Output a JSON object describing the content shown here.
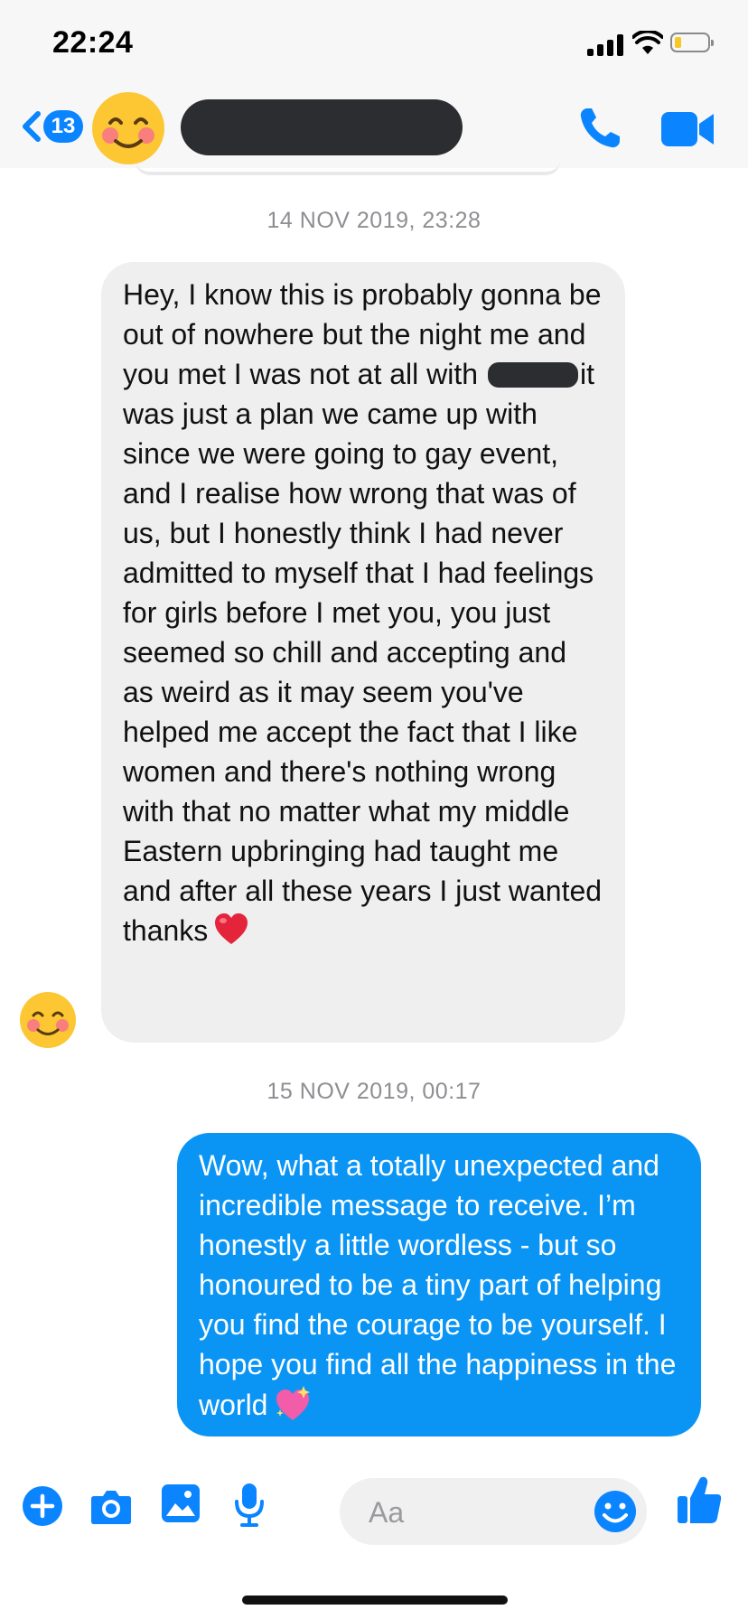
{
  "status_bar": {
    "time": "22:24",
    "battery_level": 0.2,
    "icons": [
      "cellular-signal-icon",
      "wifi-icon",
      "battery-icon"
    ]
  },
  "header": {
    "back_badge_count": "13",
    "avatar_emoji": "smiling-face-with-smiling-eyes-icon",
    "contact_name_redacted": true,
    "icons": [
      "back-chevron-icon",
      "phone-call-icon",
      "video-call-icon"
    ],
    "accent_color": "#0a84ff"
  },
  "conversation": {
    "messages": [
      {
        "timestamp": "14 NOV 2019, 23:28",
        "direction": "incoming",
        "text_before_redaction": "Hey, I know this is probably gonna be out of nowhere but the night me and you met I was not at all with",
        "text_after_redaction": "it was just a plan we came up with since we were going to gay event, and I realise how wrong that was of us, but I honestly think I had never admitted to myself that I had feelings for girls before I met you, you just seemed so chill and accepting and as weird as it may seem you've helped me accept the fact that I like women and there's nothing wrong with that no matter what my middle Eastern upbringing had taught me and after all these years I just wanted thanks",
        "emoji": "red-heart-icon",
        "bubble_color": "#efefef"
      },
      {
        "timestamp": "15 NOV 2019, 00:17",
        "direction": "outgoing",
        "text": "Wow, what a totally unexpected and incredible message to receive. I’m honestly a little wordless - but so honoured to be a tiny part of helping you find the courage to be yourself. I hope you find all the happiness in the world",
        "emoji": "sparkling-heart-icon",
        "bubble_color": "#0a95f5"
      }
    ]
  },
  "composer": {
    "placeholder": "Aa",
    "value": "",
    "icons": [
      "plus-icon",
      "camera-icon",
      "photo-gallery-icon",
      "microphone-icon",
      "emoji-icon",
      "thumbs-up-icon"
    ]
  }
}
